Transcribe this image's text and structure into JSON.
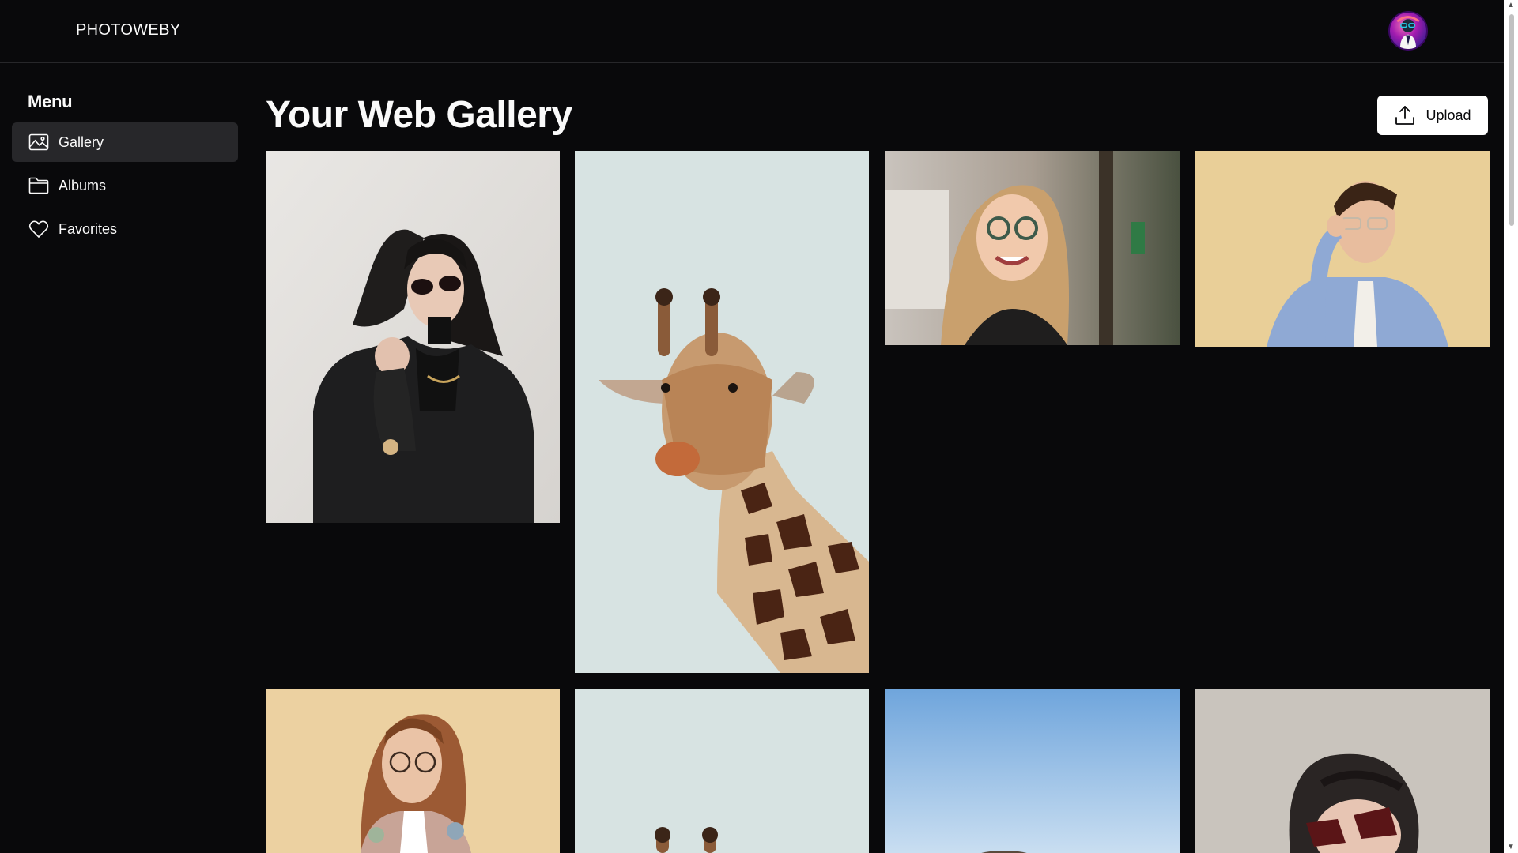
{
  "app": {
    "brand": "PHOTOWEBY"
  },
  "sidebar": {
    "title": "Menu",
    "items": [
      {
        "label": "Gallery",
        "icon": "image-icon",
        "active": true
      },
      {
        "label": "Albums",
        "icon": "folder-icon",
        "active": false
      },
      {
        "label": "Favorites",
        "icon": "heart-icon",
        "active": false
      }
    ]
  },
  "main": {
    "title": "Your Web Gallery",
    "upload_label": "Upload"
  },
  "photos": [
    {
      "subject": "woman in black blazer and sunglasses"
    },
    {
      "subject": "giraffe"
    },
    {
      "subject": "smiling woman with glasses"
    },
    {
      "subject": "man adjusting glasses"
    },
    {
      "subject": "woman in floral cardigan with glasses"
    },
    {
      "subject": "giraffe"
    },
    {
      "subject": "blue sky"
    },
    {
      "subject": "woman with red sunglasses"
    }
  ],
  "colors": {
    "background": "#09090b",
    "active_nav": "#27272a",
    "button_bg": "#ffffff"
  }
}
